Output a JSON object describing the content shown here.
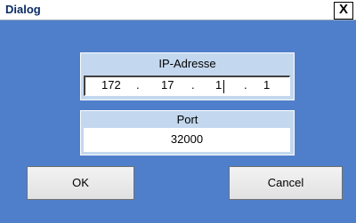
{
  "window": {
    "title": "Dialog",
    "close_label": "X"
  },
  "ip_section": {
    "label": "IP-Adresse",
    "octets": [
      "172",
      "17",
      "1",
      "1"
    ],
    "separator": "."
  },
  "port_section": {
    "label": "Port",
    "value": "32000"
  },
  "buttons": {
    "ok": "OK",
    "cancel": "Cancel"
  },
  "colors": {
    "background": "#4f7fcb",
    "panel": "#c3d8ee",
    "title_text": "#0b2a66"
  }
}
